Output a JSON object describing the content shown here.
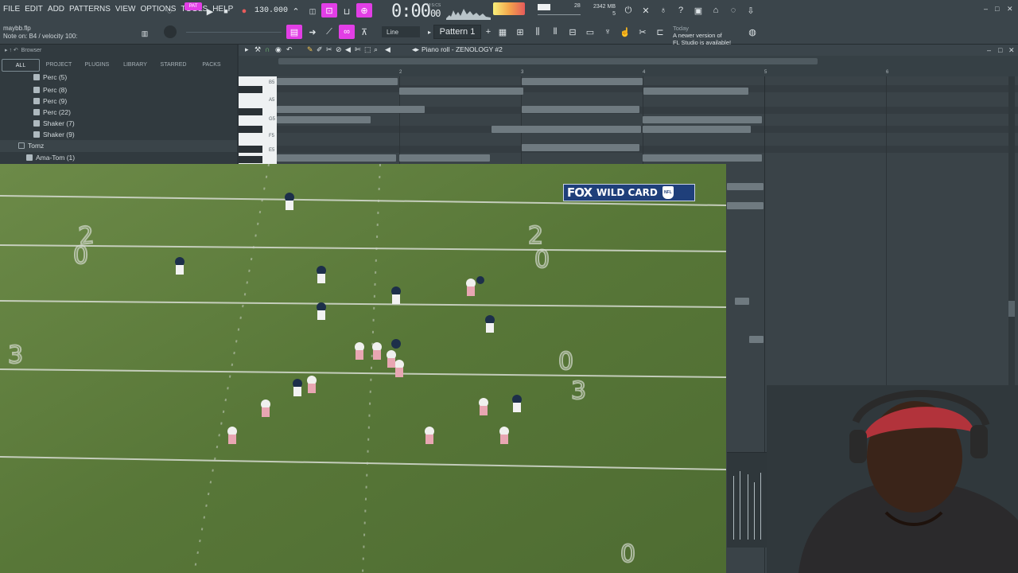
{
  "menu": [
    "FILE",
    "EDIT",
    "ADD",
    "PATTERNS",
    "VIEW",
    "OPTIONS",
    "TOOLS",
    "HELP"
  ],
  "song": {
    "file": "maybb.flp",
    "hint": "Note on: B4 / velocity 100:"
  },
  "transport": {
    "pat_label": "PAT",
    "tempo": "130.000",
    "time_main": "0:00",
    "time_frac": "00",
    "time_unit": "M:S:CS"
  },
  "perf": {
    "cpu": "28",
    "mem": "2342 MB",
    "mem_sub": "5"
  },
  "toolbar": {
    "snap_mode": "Line",
    "pattern": "Pattern 1"
  },
  "news": {
    "label": "Today",
    "line1": "A newer version of",
    "line2": "FL Studio is available!"
  },
  "browser": {
    "title": "Browser",
    "tabs": [
      "ALL",
      "PROJECT",
      "PLUGINS",
      "LIBRARY",
      "STARRED",
      "PACKS"
    ],
    "active_tab": "ALL",
    "items": [
      {
        "label": "Perc (5)",
        "type": "file"
      },
      {
        "label": "Perc (8)",
        "type": "file"
      },
      {
        "label": "Perc (9)",
        "type": "file"
      },
      {
        "label": "Perc (22)",
        "type": "file"
      },
      {
        "label": "Shaker (7)",
        "type": "file"
      },
      {
        "label": "Shaker (9)",
        "type": "file"
      },
      {
        "label": "Tomz",
        "type": "folder"
      },
      {
        "label": "Ama-Tom (1)",
        "type": "file"
      }
    ]
  },
  "piano_roll": {
    "title": "Piano roll - ZENOLOGY #2",
    "bars": [
      "2",
      "3",
      "4",
      "5",
      "6"
    ],
    "keys": [
      "B5",
      "A5",
      "G5",
      "F5",
      "E5"
    ]
  },
  "overlay": {
    "network": "FOX",
    "title": "WILD CARD",
    "league": "NFL"
  },
  "colors": {
    "accent": "#e23ee6",
    "panel": "#3b454b",
    "field": "#5c7a3e"
  }
}
